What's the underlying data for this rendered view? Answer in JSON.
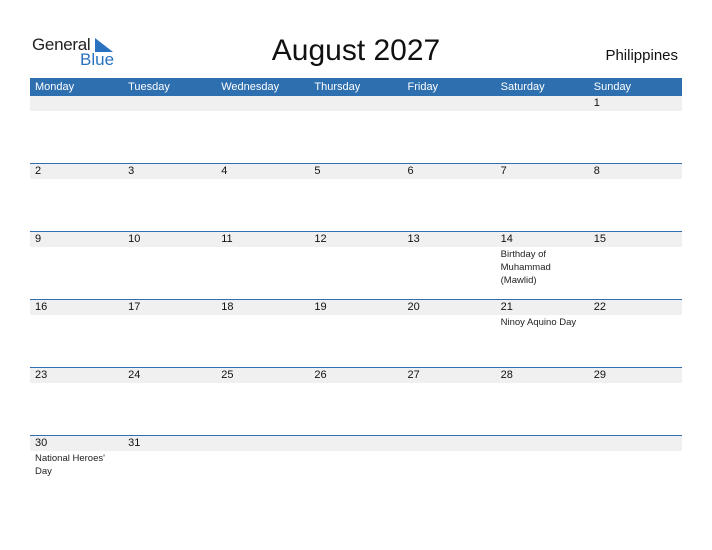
{
  "logo": {
    "line1": "General",
    "line2": "Blue",
    "icon": "triangle-flag-icon"
  },
  "title": "August 2027",
  "country": "Philippines",
  "colors": {
    "accent": "#2e6fb0",
    "band": "#f0f0f0",
    "logo_blue": "#2a72c0"
  },
  "weekdays": [
    "Monday",
    "Tuesday",
    "Wednesday",
    "Thursday",
    "Friday",
    "Saturday",
    "Sunday"
  ],
  "weeks": [
    [
      {
        "d": ""
      },
      {
        "d": ""
      },
      {
        "d": ""
      },
      {
        "d": ""
      },
      {
        "d": ""
      },
      {
        "d": ""
      },
      {
        "d": "1"
      }
    ],
    [
      {
        "d": "2"
      },
      {
        "d": "3"
      },
      {
        "d": "4"
      },
      {
        "d": "5"
      },
      {
        "d": "6"
      },
      {
        "d": "7"
      },
      {
        "d": "8"
      }
    ],
    [
      {
        "d": "9"
      },
      {
        "d": "10"
      },
      {
        "d": "11"
      },
      {
        "d": "12"
      },
      {
        "d": "13"
      },
      {
        "d": "14",
        "h": "Birthday of Muhammad (Mawlid)"
      },
      {
        "d": "15"
      }
    ],
    [
      {
        "d": "16"
      },
      {
        "d": "17"
      },
      {
        "d": "18"
      },
      {
        "d": "19"
      },
      {
        "d": "20"
      },
      {
        "d": "21",
        "h": "Ninoy Aquino Day"
      },
      {
        "d": "22"
      }
    ],
    [
      {
        "d": "23"
      },
      {
        "d": "24"
      },
      {
        "d": "25"
      },
      {
        "d": "26"
      },
      {
        "d": "27"
      },
      {
        "d": "28"
      },
      {
        "d": "29"
      }
    ],
    [
      {
        "d": "30",
        "h": "National Heroes' Day"
      },
      {
        "d": "31"
      },
      {
        "d": ""
      },
      {
        "d": ""
      },
      {
        "d": ""
      },
      {
        "d": ""
      },
      {
        "d": ""
      }
    ]
  ]
}
